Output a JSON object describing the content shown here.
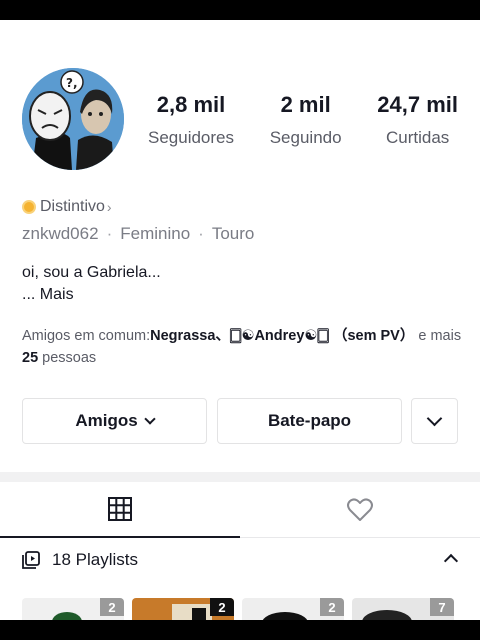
{
  "profile": {
    "stats": [
      {
        "value": "2,8 mil",
        "label": "Seguidores"
      },
      {
        "value": "2 mil",
        "label": "Seguindo"
      },
      {
        "value": "24,7 mil",
        "label": "Curtidas"
      }
    ],
    "badge_label": "Distintivo",
    "username": "znkwd062",
    "gender": "Feminino",
    "zodiac": "Touro",
    "bio_line": "oi, sou a Gabriela...",
    "bio_more": "...  Mais",
    "mutual_prefix": "Amigos em comum:",
    "mutual_names": "Negrassa、🀆☯Andrey☯🀆 （sem PV）",
    "mutual_mid": " e mais ",
    "mutual_count": "25",
    "mutual_suffix": " pessoas"
  },
  "actions": {
    "friends_label": "Amigos",
    "chat_label": "Bate-papo"
  },
  "tabs": [
    {
      "icon": "grid-icon",
      "active": true
    },
    {
      "icon": "heart-icon",
      "active": false
    }
  ],
  "playlists": {
    "label": "18 Playlists",
    "thumb_counts": [
      "2",
      "2",
      "2",
      "7"
    ]
  },
  "colors": {
    "badge": "#f5b331",
    "text_primary": "#161823",
    "text_secondary": "#5a5c66"
  }
}
